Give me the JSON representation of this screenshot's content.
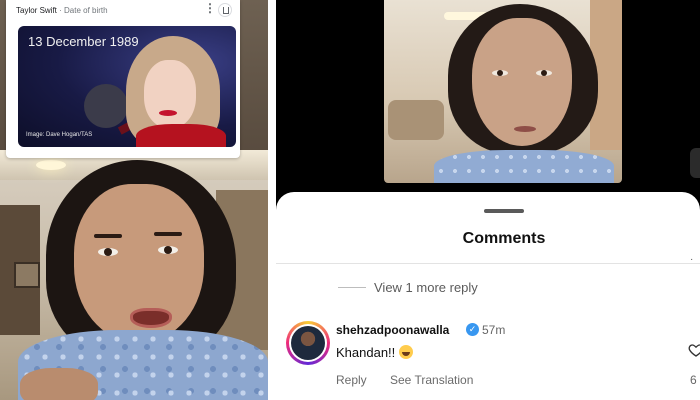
{
  "google_card": {
    "title": "Taylor Swift",
    "subtitle": "· Date of birth",
    "more_icon": "more-vert-icon",
    "share_icon": "share-icon",
    "date": "13 December 1989",
    "credit": "Image: Dave Hogan/TAS"
  },
  "comments_sheet": {
    "title": "Comments",
    "view_more": "View 1 more reply",
    "comment": {
      "username": "shehzadpoonawalla",
      "verified_icon": "verified-badge-icon",
      "time": "57m",
      "text": "Khandan!!",
      "emoji": "laughing-emoji-icon",
      "reply_label": "Reply",
      "translate_label": "See Translation",
      "like_icon": "heart-icon",
      "like_count": "6"
    }
  },
  "colors": {
    "verified": "#3897f0",
    "sheet_bg": "#ffffff",
    "video_frame_bg": "#000000"
  }
}
